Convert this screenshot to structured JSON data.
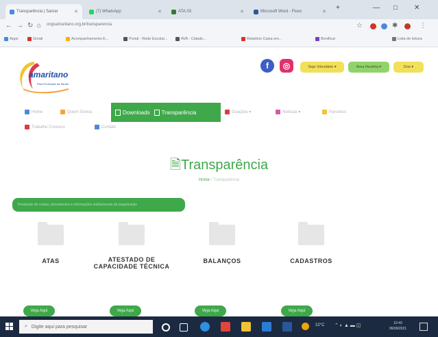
{
  "browser": {
    "tabs": [
      {
        "label": "Transparência | Samar",
        "color": "#4a8bd8",
        "active": true
      },
      {
        "label": "(7) WhatsApp",
        "color": "#25d366",
        "active": false
      },
      {
        "label": "ATA.03",
        "color": "#2e7d32",
        "active": false
      },
      {
        "label": "Microsoft Word - Fluxo",
        "color": "#2b579a",
        "active": false
      }
    ],
    "new_tab": "+",
    "window_controls": [
      "—",
      "□",
      "✕"
    ],
    "url": "ongsamaritano.org.br/transparencia",
    "bookmarks": [
      {
        "label": "Apps",
        "color": "#4a8bd8"
      },
      {
        "label": "Gmail",
        "color": "#d93025"
      },
      {
        "label": "Acompanhamento E...",
        "color": "#f4b400"
      },
      {
        "label": "Portal - Rede Escolar...",
        "color": "#555"
      },
      {
        "label": "AVA - Cidade...",
        "color": "#555"
      },
      {
        "label": "Relatório Caixa em...",
        "color": "#d93025"
      },
      {
        "label": "Bonificar",
        "color": "#7b3fbf"
      },
      {
        "label": "Lista de leitura",
        "color": "#777"
      }
    ]
  },
  "site": {
    "logo_text": "amaritano",
    "logo_sub": "Para Promoção da Saúde",
    "social": {
      "facebook": "f",
      "instagram": "◎"
    },
    "pills": [
      {
        "label": "Seja Voluntário ▾",
        "color": "#f1e05a"
      },
      {
        "label": "Área Restrita ▾",
        "color": "#8fd46a"
      },
      {
        "label": "Doe ▾",
        "color": "#f1e05a"
      }
    ],
    "menu_row1": [
      {
        "label": "Home",
        "icon_color": "#4a8bd8"
      },
      {
        "label": "Quem Somos",
        "icon_color": "#f4a340"
      }
    ],
    "menu_green": [
      "Downloads",
      "Transparência"
    ],
    "menu_row1b": [
      {
        "label": "Doações ▾",
        "icon_color": "#d93b50"
      },
      {
        "label": "Notícias ▾",
        "icon_color": "#d65aa3"
      },
      {
        "label": "Parceiros",
        "icon_color": "#f1c232"
      }
    ],
    "menu_row2": [
      {
        "label": "Trabalhe Conosco",
        "icon_color": "#d93b50"
      },
      {
        "label": "Contato",
        "icon_color": "#4a8bd8"
      }
    ],
    "page_title": "Transparência",
    "breadcrumb": {
      "home": "Home",
      "separator": "/",
      "current": "Transparência"
    },
    "banner": "Prestação de contas, documentos e informações institucionais da organização",
    "cards": [
      {
        "title": "ATAS",
        "button": "Veja Aqui"
      },
      {
        "title": "ATESTADO DE CAPACIDADE TÉCNICA",
        "button": "Veja Aqui"
      },
      {
        "title": "BALANÇOS",
        "button": "Veja Aqui"
      },
      {
        "title": "CADASTROS",
        "button": "Veja Aqui"
      }
    ]
  },
  "taskbar": {
    "search_placeholder": "Digite aqui para pesquisar",
    "weather": "22°C",
    "time": "10:43",
    "date": "06/09/2021"
  }
}
